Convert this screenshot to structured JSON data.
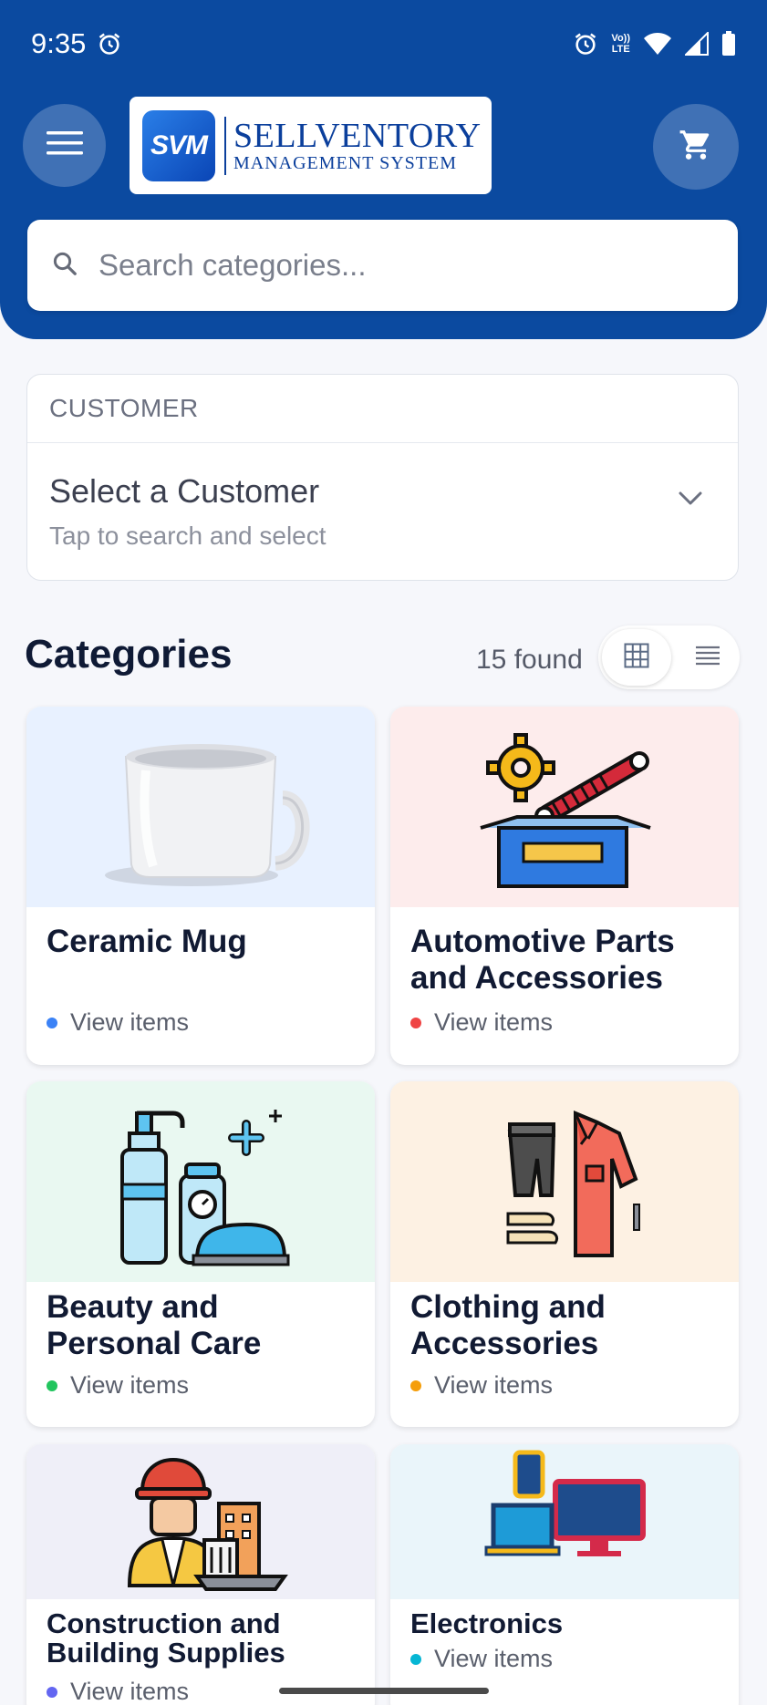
{
  "status_bar": {
    "time": "9:35",
    "net_label_top": "Vo))",
    "net_label_bottom": "LTE"
  },
  "header": {
    "logo": {
      "mark": "SVM",
      "line1": "SELLVENTORY",
      "line2": "MANAGEMENT SYSTEM"
    },
    "search": {
      "placeholder": "Search categories..."
    }
  },
  "customer": {
    "section_label": "CUSTOMER",
    "select_title": "Select a Customer",
    "select_hint": "Tap to search and select"
  },
  "categories": {
    "title": "Categories",
    "count_text": "15 found",
    "items": [
      {
        "name": "Ceramic Mug",
        "action": "View items",
        "dot_color": "#3b82f6",
        "bg": "#e8f1ff"
      },
      {
        "name": "Automotive Parts and Accessories",
        "action": "View items",
        "dot_color": "#ef4444",
        "bg": "#fdecec"
      },
      {
        "name": "Beauty and Personal Care",
        "action": "View items",
        "dot_color": "#22c55e",
        "bg": "#e9f8f1"
      },
      {
        "name": "Clothing and Accessories",
        "action": "View items",
        "dot_color": "#f59e0b",
        "bg": "#fdf1e3"
      },
      {
        "name": "Construction and Building Supplies",
        "action": "View items",
        "dot_color": "#6366f1",
        "bg": "#efeff8"
      },
      {
        "name": "Electronics",
        "action": "View items",
        "dot_color": "#06b6d4",
        "bg": "#eaf5fa"
      }
    ]
  },
  "colors": {
    "primary": "#0b4aa0",
    "background": "#f6f7fb"
  }
}
